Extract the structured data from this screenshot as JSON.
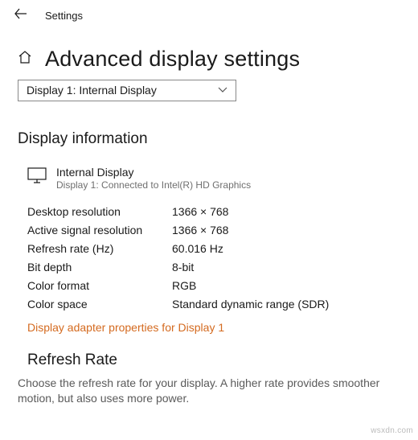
{
  "titlebar": {
    "label": "Settings"
  },
  "page": {
    "title": "Advanced display settings"
  },
  "display_select": {
    "selected": "Display 1: Internal Display"
  },
  "sections": {
    "display_info_title": "Display information",
    "refresh_rate_title": "Refresh Rate",
    "refresh_rate_desc": "Choose the refresh rate for your display. A higher rate provides smoother motion, but also uses more power."
  },
  "monitor": {
    "name": "Internal Display",
    "sub": "Display 1: Connected to Intel(R) HD Graphics"
  },
  "info": {
    "rows": [
      {
        "label": "Desktop resolution",
        "value": "1366 × 768"
      },
      {
        "label": "Active signal resolution",
        "value": "1366 × 768"
      },
      {
        "label": "Refresh rate (Hz)",
        "value": "60.016 Hz"
      },
      {
        "label": "Bit depth",
        "value": "8-bit"
      },
      {
        "label": "Color format",
        "value": "RGB"
      },
      {
        "label": "Color space",
        "value": "Standard dynamic range (SDR)"
      }
    ]
  },
  "link": {
    "adapter_properties": "Display adapter properties for Display 1"
  },
  "watermark": "wsxdn.com"
}
